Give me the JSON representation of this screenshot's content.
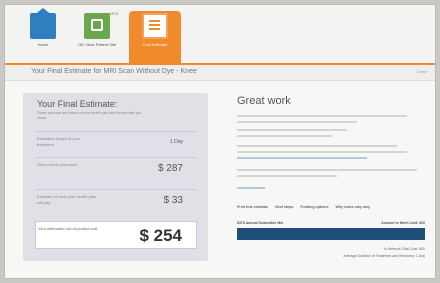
{
  "toolbar": {
    "items": [
      {
        "label": "Home",
        "icon": "home-icon"
      },
      {
        "label": "HIC Near Patient Site",
        "icon": "find-icon"
      },
      {
        "label": "Cost Estimate",
        "icon": "document-icon"
      }
    ],
    "badge": "NEW"
  },
  "titlebar": {
    "title": "Your Final Estimate for MRI Scan Without Dye - Knee",
    "action": "Close"
  },
  "estimate": {
    "heading": "Your Final Estimate:",
    "subtext": "These amounts are based on your health plan and the provider you chose.",
    "rows": [
      {
        "label": "Estimated length of your treatment",
        "value": "1 Day"
      },
      {
        "label": "Total cost of procedure",
        "value": "$ 287"
      },
      {
        "label": "Estimate of what your health plan will pay",
        "value": "$ 33"
      }
    ],
    "total": {
      "label": "Your estimated out-of-pocket cost",
      "value": "$ 254"
    }
  },
  "great": {
    "heading": "Great work",
    "links": [
      "Print this estimate",
      "Next steps",
      "Funding options",
      "Why costs may vary"
    ],
    "bar_left": "$378 Annual Deductible Met",
    "bar_right": "Amount to Meet Limit: $20",
    "note1": "In Network Total Cost: $00",
    "note2": "Average Duration of Treatment and Recovery: 1 Day"
  },
  "colors": {
    "accent": "#f08a2a",
    "bar": "#1f4e79",
    "panel": "#dfe1e6"
  }
}
